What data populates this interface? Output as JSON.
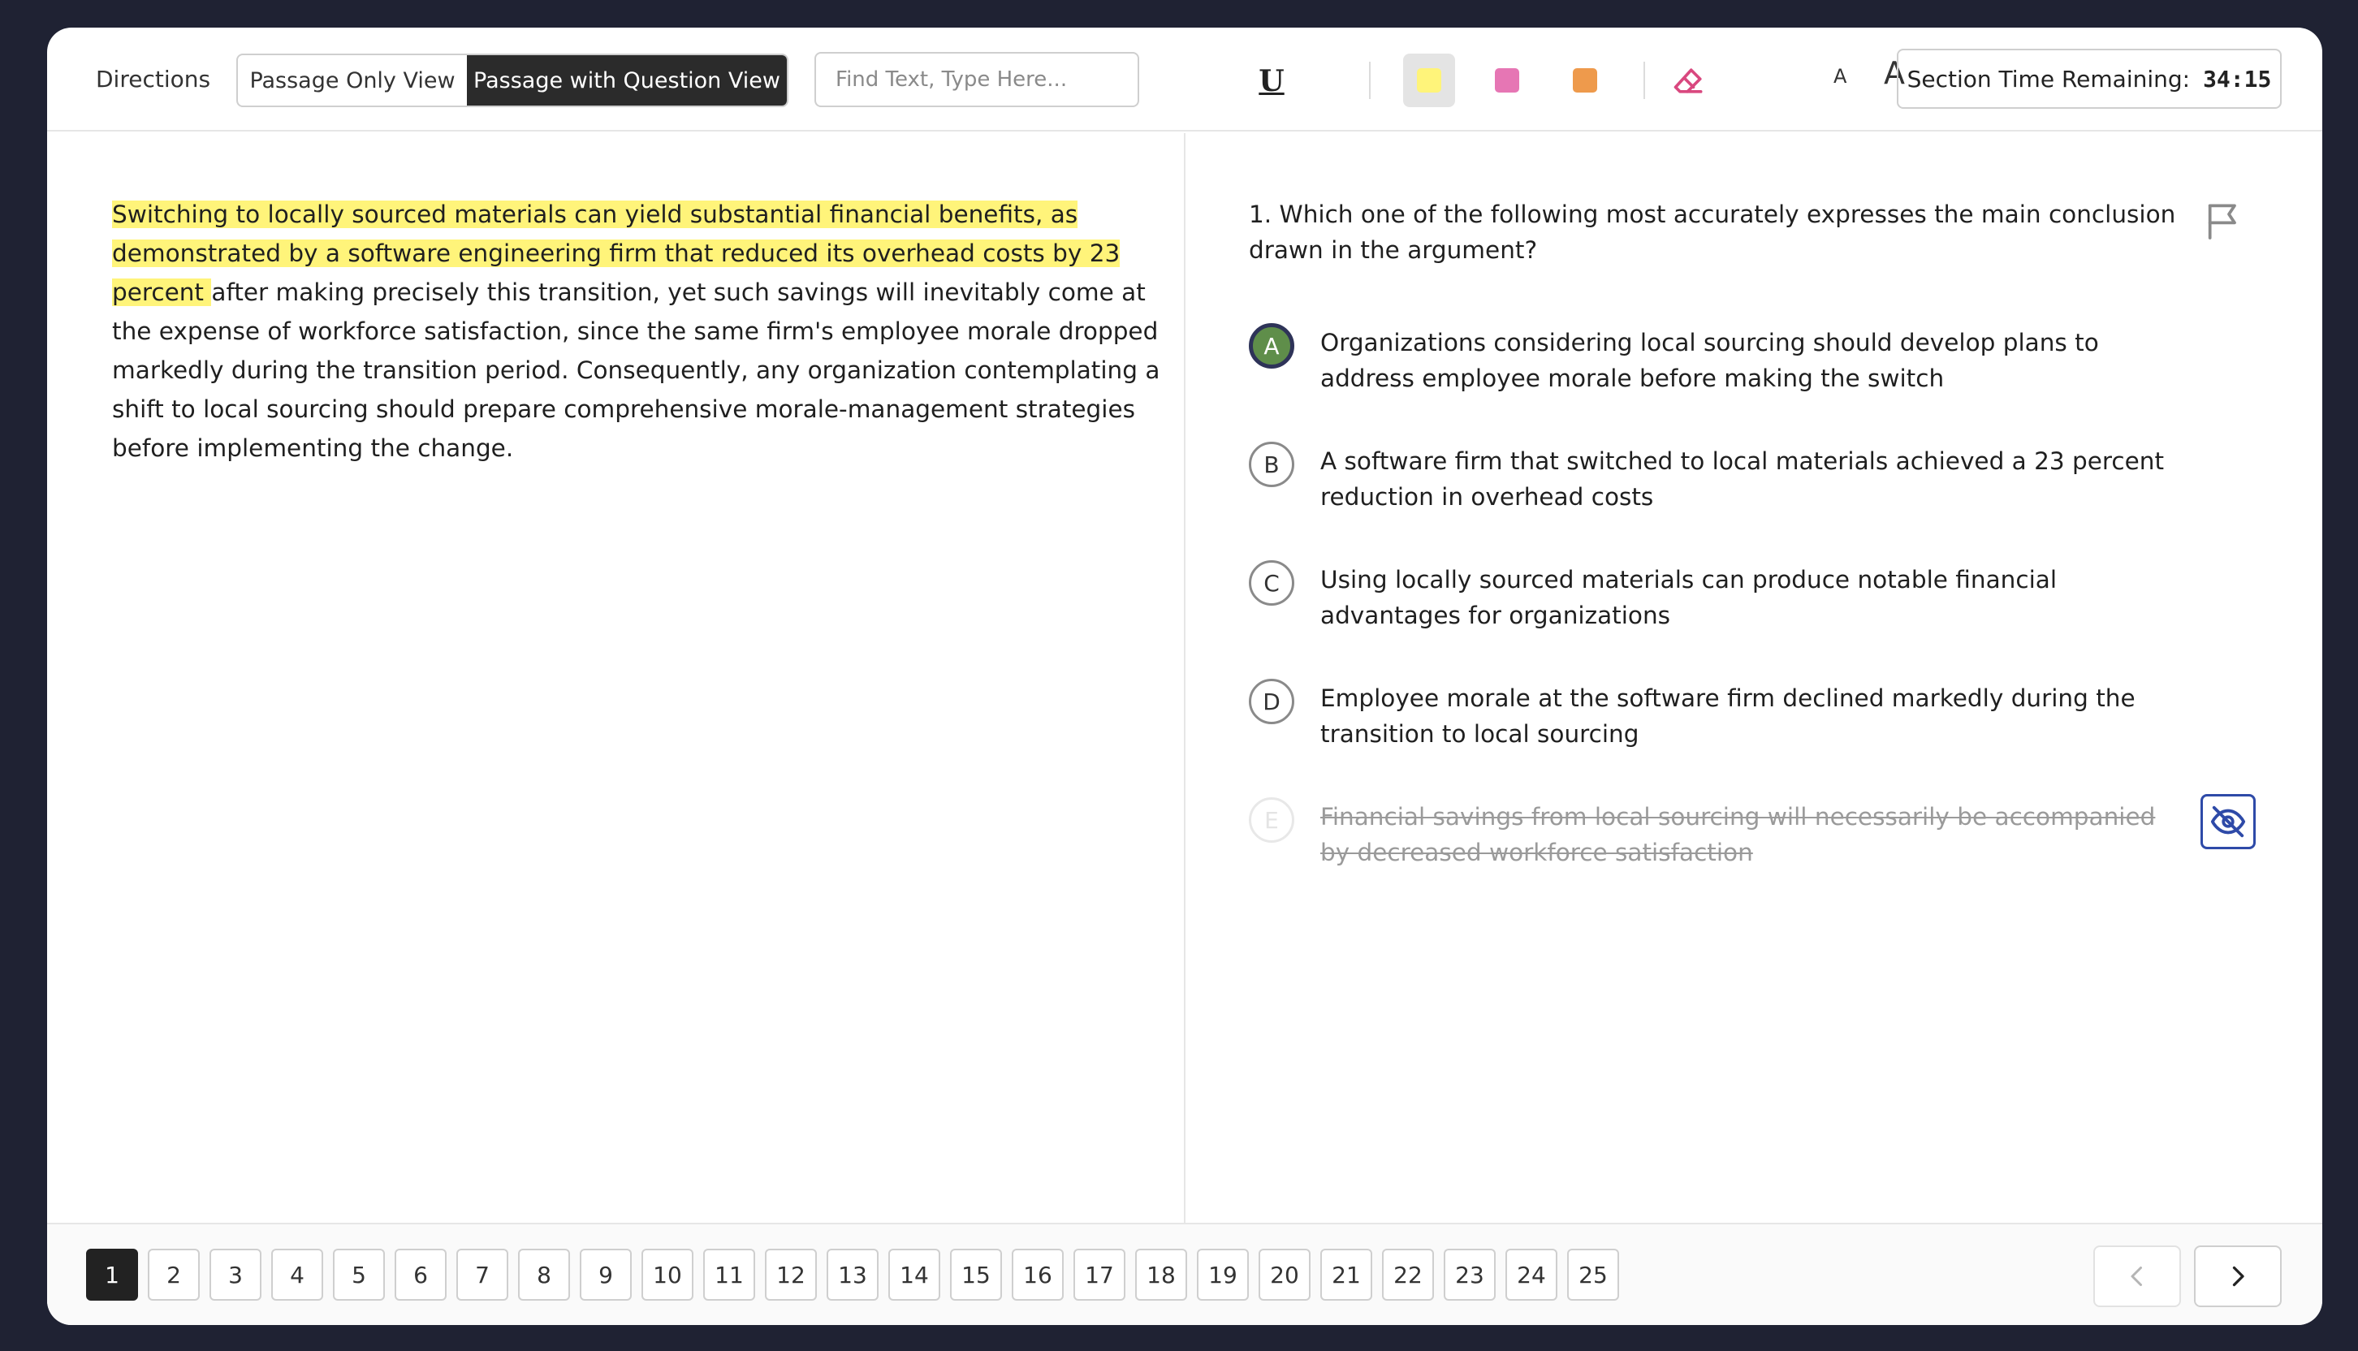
{
  "toolbar": {
    "directions_label": "Directions",
    "view_options": [
      "Passage Only View",
      "Passage with Question View"
    ],
    "active_view": "Passage with Question View",
    "find_placeholder": "Find Text, Type Here...",
    "underline_label": "U",
    "highlight_colors": [
      "#fff47a",
      "#e676b4",
      "#ee9a4c"
    ],
    "selected_highlight": "#fff47a",
    "eraser_color": "#d9487f",
    "font_small_label": "A",
    "font_large_label": "A",
    "timer_label": "Section Time Remaining:",
    "timer_value": "34:15"
  },
  "passage": {
    "highlighted": "Switching to locally sourced materials can yield substantial financial benefits, as demonstrated by a software engineering firm that reduced its overhead costs by 23 percent ",
    "rest": "after making precisely this transition, yet such savings will inevitably come at the expense of workforce satisfaction, since the same firm's employee morale dropped markedly during the transition period. Consequently, any organization contemplating a shift to local sourcing should prepare comprehensive morale-management strategies before implementing the change."
  },
  "question": {
    "text": "1. Which one of the following most accurately expresses the main conclusion drawn in the argument?",
    "choices": [
      {
        "letter": "A",
        "text": "Organizations considering local sourcing should develop plans to address employee morale before making the switch",
        "state": "selected"
      },
      {
        "letter": "B",
        "text": "A software firm that switched to local materials achieved a 23 percent reduction in overhead costs",
        "state": "normal"
      },
      {
        "letter": "C",
        "text": "Using locally sourced materials can produce notable financial advantages for organizations",
        "state": "normal"
      },
      {
        "letter": "D",
        "text": "Employee morale at the software firm declined markedly during the transition to local sourcing",
        "state": "normal"
      },
      {
        "letter": "E",
        "text": "Financial savings from local sourcing will necessarily be accompanied by decreased workforce satisfaction",
        "state": "struck"
      }
    ]
  },
  "navigation": {
    "pages": [
      "1",
      "2",
      "3",
      "4",
      "5",
      "6",
      "7",
      "8",
      "9",
      "10",
      "11",
      "12",
      "13",
      "14",
      "15",
      "16",
      "17",
      "18",
      "19",
      "20",
      "21",
      "22",
      "23",
      "24",
      "25"
    ],
    "current_page": "1"
  },
  "colors": {
    "selected_bubble_fill": "#5f8e4a",
    "selected_bubble_ring": "#2e3358",
    "eye_button_border": "#2e4aa8"
  }
}
